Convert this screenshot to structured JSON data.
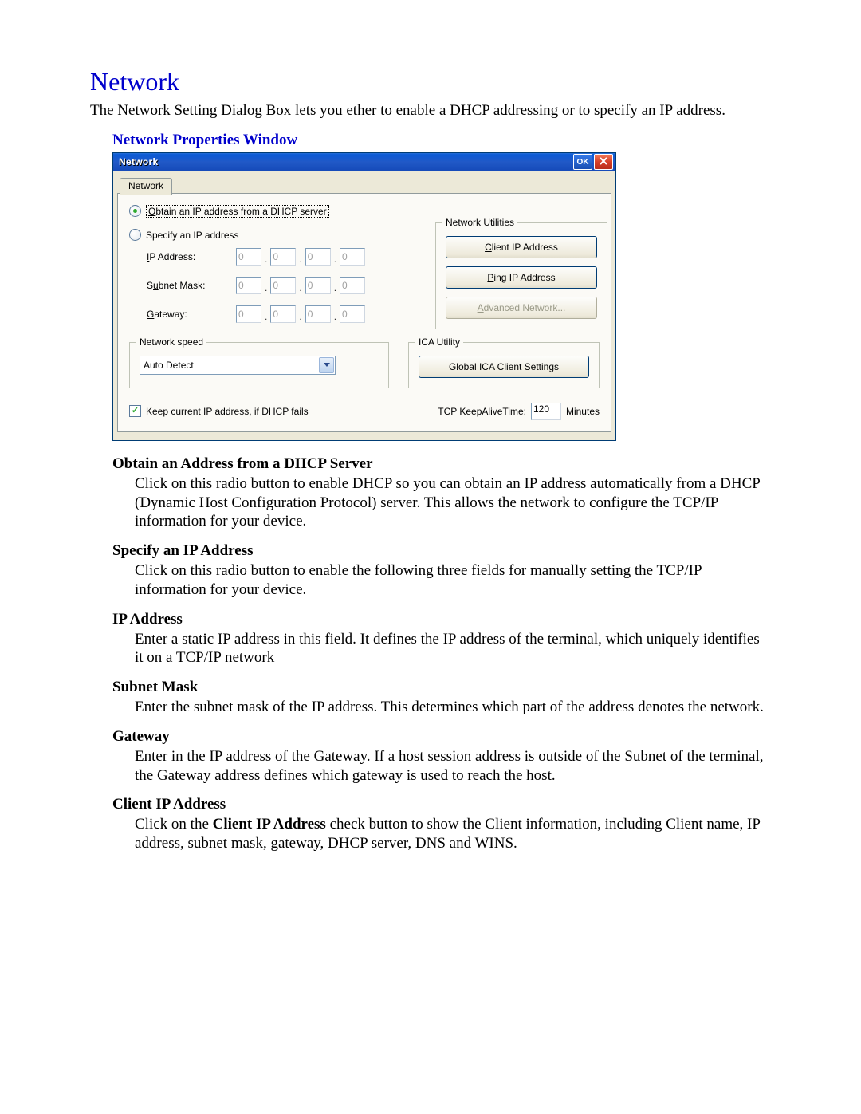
{
  "heading": "Network",
  "intro": "The Network Setting Dialog Box lets you ether to enable a DHCP addressing or to specify an IP address.",
  "caption": "Network Properties Window",
  "window": {
    "title": "Network",
    "ok": "OK",
    "tab": "Network",
    "radio_obtain": {
      "underline": "O",
      "rest": "btain an IP address from a DHCP server",
      "selected": true
    },
    "radio_specify": {
      "text": "Specify an IP address",
      "selected": false
    },
    "labels": {
      "ip": {
        "u": "I",
        "rest": "P Address:"
      },
      "subnet": {
        "pre": "S",
        "u": "u",
        "rest": "bnet Mask:"
      },
      "gateway": {
        "u": "G",
        "rest": "ateway:"
      }
    },
    "octet_placeholder": "0",
    "ip_values": [
      "0",
      "0",
      "0",
      "0"
    ],
    "subnet_values": [
      "0",
      "0",
      "0",
      "0"
    ],
    "gateway_values": [
      "0",
      "0",
      "0",
      "0"
    ],
    "utilities": {
      "legend": "Network Utilities",
      "client_btn": {
        "u": "C",
        "rest": "lient IP Address"
      },
      "ping_btn": {
        "u": "P",
        "rest": "ing IP Address"
      },
      "adv_btn": {
        "u": "A",
        "rest": "dvanced Network..."
      }
    },
    "speed": {
      "legend": "Network speed",
      "value": "Auto Detect"
    },
    "ica": {
      "legend": "ICA Utility",
      "btn": "Global ICA Client Settings"
    },
    "keep_checkbox": {
      "checked": true,
      "label": "Keep current IP address, if DHCP fails"
    },
    "keepalive": {
      "label": "TCP KeepAliveTime:",
      "value": "120",
      "unit": "Minutes"
    }
  },
  "sections": [
    {
      "term": "Obtain an Address from a DHCP Server",
      "desc": "Click on this radio button to enable DHCP so you can obtain an IP address automatically from a DHCP (Dynamic Host Configuration Protocol) server.  This allows the network to configure the TCP/IP information for your device."
    },
    {
      "term": "Specify an IP Address",
      "desc": "Click on this radio button to enable the following three fields for manually setting the TCP/IP information for your device."
    },
    {
      "term": "IP Address",
      "desc": "Enter a static IP address in this field.  It defines the IP address of the terminal, which uniquely identifies it on a TCP/IP network"
    },
    {
      "term": "Subnet Mask",
      "desc": "Enter the subnet mask of the IP address.  This determines which part of the address denotes the network."
    },
    {
      "term": "Gateway",
      "desc": "Enter in the IP address of the Gateway.  If a host session address is outside of the Subnet of the terminal, the Gateway address defines which gateway is used to reach the host."
    },
    {
      "term": "Client IP Address",
      "desc_pre": "Click on the ",
      "desc_bold": "Client IP Address",
      "desc_post": " check button to show the Client information, including Client name, IP address, subnet mask, gateway, DHCP server, DNS and WINS."
    }
  ]
}
